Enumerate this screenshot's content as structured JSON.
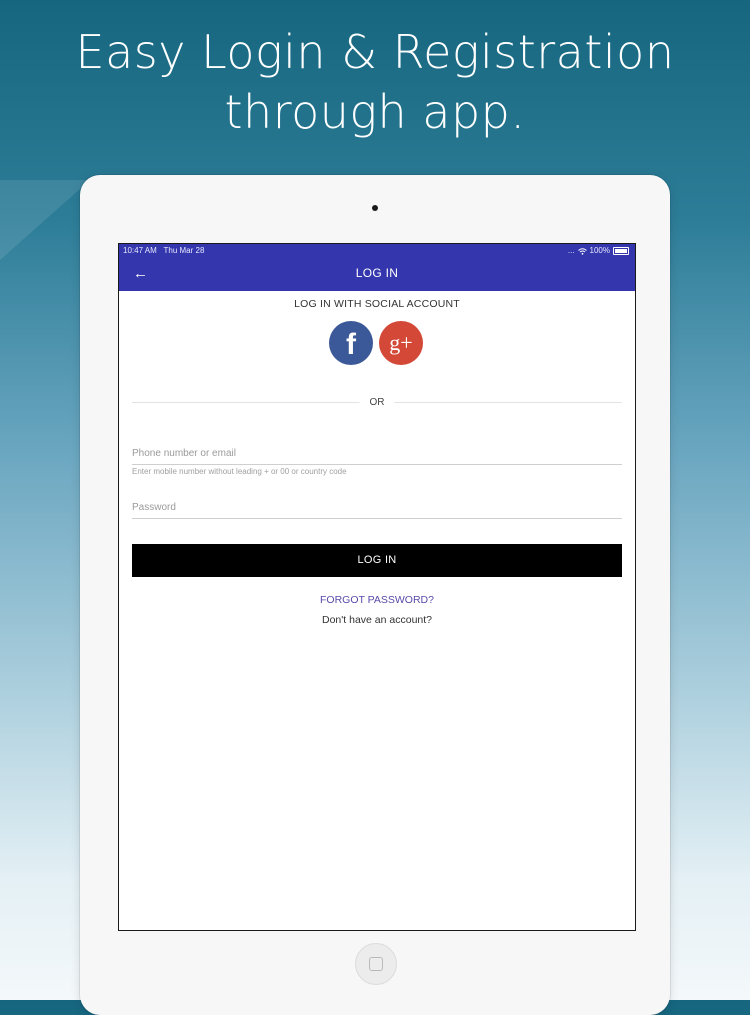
{
  "headline": {
    "line1": "Easy Login & Registration",
    "line2": "through app."
  },
  "status_bar": {
    "time": "10:47 AM",
    "date": "Thu Mar 28",
    "signal": "...",
    "wifi_icon": "wifi-icon",
    "battery": "100%"
  },
  "app_bar": {
    "back_icon": "back-arrow-icon",
    "title": "LOG IN",
    "color": "#3336ad"
  },
  "social": {
    "title": "LOG IN WITH SOCIAL ACCOUNT",
    "facebook_glyph": "f",
    "google_glyph": "g+",
    "facebook_color": "#3b5998",
    "google_color": "#d34836"
  },
  "separator": {
    "text": "OR"
  },
  "form": {
    "phone_placeholder": "Phone number or email",
    "phone_hint": "Enter mobile number without leading + or 00 or country code",
    "password_placeholder": "Password"
  },
  "actions": {
    "login_label": "LOG IN",
    "forgot_password": "FORGOT PASSWORD?",
    "signup_prompt": "Don't have an account?"
  }
}
